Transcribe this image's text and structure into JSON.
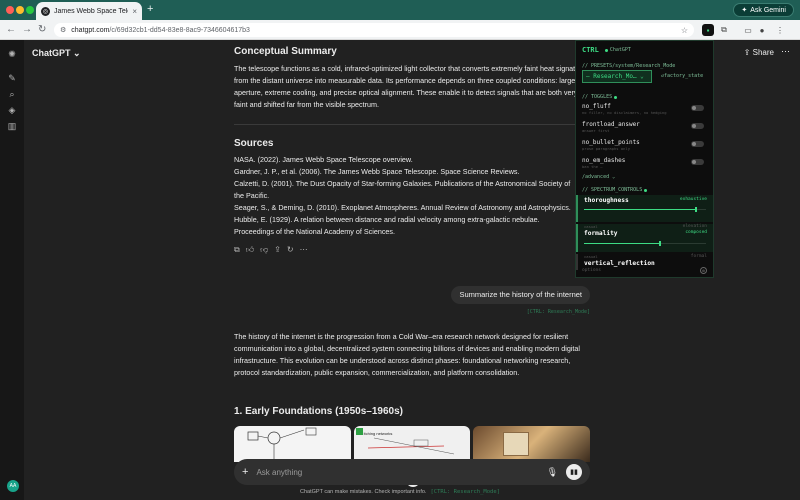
{
  "browser": {
    "tab_title": "James Webb Space Telescope",
    "tab_close": "×",
    "new_tab": "+",
    "address_host": "chatgpt.com",
    "address_path": "/c/69d32cb1-dd54-83e8-8ac9-7346604617b3",
    "ask_gemini": "Ask Gemini",
    "nav_back": "←",
    "nav_forward": "→",
    "nav_reload": "↻"
  },
  "app": {
    "model": "ChatGPT ⌄",
    "share": "Share",
    "more": "⋯",
    "avatar_initials": "AA"
  },
  "chat": {
    "summary_heading": "Conceptual Summary",
    "summary_text": "The telescope functions as a cold, infrared-optimized light collector that converts extremely faint heat signatures from the distant universe into measurable data. Its performance depends on three coupled conditions: large aperture, extreme cooling, and precise optical alignment. These enable it to detect signals that are both very faint and shifted far from the visible spectrum.",
    "sources_heading": "Sources",
    "sources": [
      "NASA. (2022). James Webb Space Telescope overview.",
      "Gardner, J. P., et al. (2006). The James Webb Space Telescope. Space Science Reviews.",
      "Calzetti, D. (2001). The Dust Opacity of Star-forming Galaxies. Publications of the Astronomical Society of",
      "the Pacific.",
      "Seager, S., & Deming, D. (2010). Exoplanet Atmospheres. Annual Review of Astronomy and Astrophysics.",
      "Hubble, E. (1929). A relation between distance and radial velocity among extra-galactic nebulae.",
      "Proceedings of the National Academy of Sciences."
    ],
    "user_message": "Summarize the history of the internet",
    "user_ctrl_tag": "[CTRL: Research_Mode]",
    "history_text": "The history of the internet is the progression from a Cold War–era research network designed for resilient communication into a global, decentralized system connecting billions of devices and enabling modern digital infrastructure. This evolution can be understood across distinct phases: foundational networking research, protocol standardization, public expansion, commercialization, and platform consolidation.",
    "early_heading": "1. Early Foundations (1950s–1960s)",
    "thumb_label": "itching networks"
  },
  "composer": {
    "placeholder": "Ask anything",
    "plus": "+",
    "disclaimer": "ChatGPT can make mistakes. Check important info.",
    "disclaimer_tag": "[CTRL: Research_Mode]"
  },
  "ctrl": {
    "brand": "CTRL",
    "provider": "ChatGPT",
    "presets_label": "// PRESETS/system/Research_Mode",
    "preset_selected": "— Research_Mo… ⌄",
    "factory_state": "↺factory_state",
    "toggles_label": "// TOGGLES",
    "toggles": [
      {
        "name": "no_fluff",
        "sub": "no filler, no disclaimers, no hedging"
      },
      {
        "name": "frontload_answer",
        "sub": "answer first"
      },
      {
        "name": "no_bullet_points",
        "sub": "prose paragraphs only"
      },
      {
        "name": "no_em_dashes",
        "sub": "ban the —"
      }
    ],
    "advanced_label": "/advanced ⌄",
    "spectrum_label": "// SPECTRUM_CONTROLS",
    "spectrum": [
      {
        "name": "thoroughness",
        "value": "exhaustive",
        "level": 0.92,
        "lo": "",
        "hi": ""
      },
      {
        "name": "formality",
        "value": "composed",
        "level": 0.62,
        "lo": "casual",
        "hi": "elevation"
      },
      {
        "name": "vertical_reflection",
        "value": "",
        "level": 0.5,
        "lo": "casual",
        "hi": "formal"
      }
    ],
    "footer": "options"
  }
}
